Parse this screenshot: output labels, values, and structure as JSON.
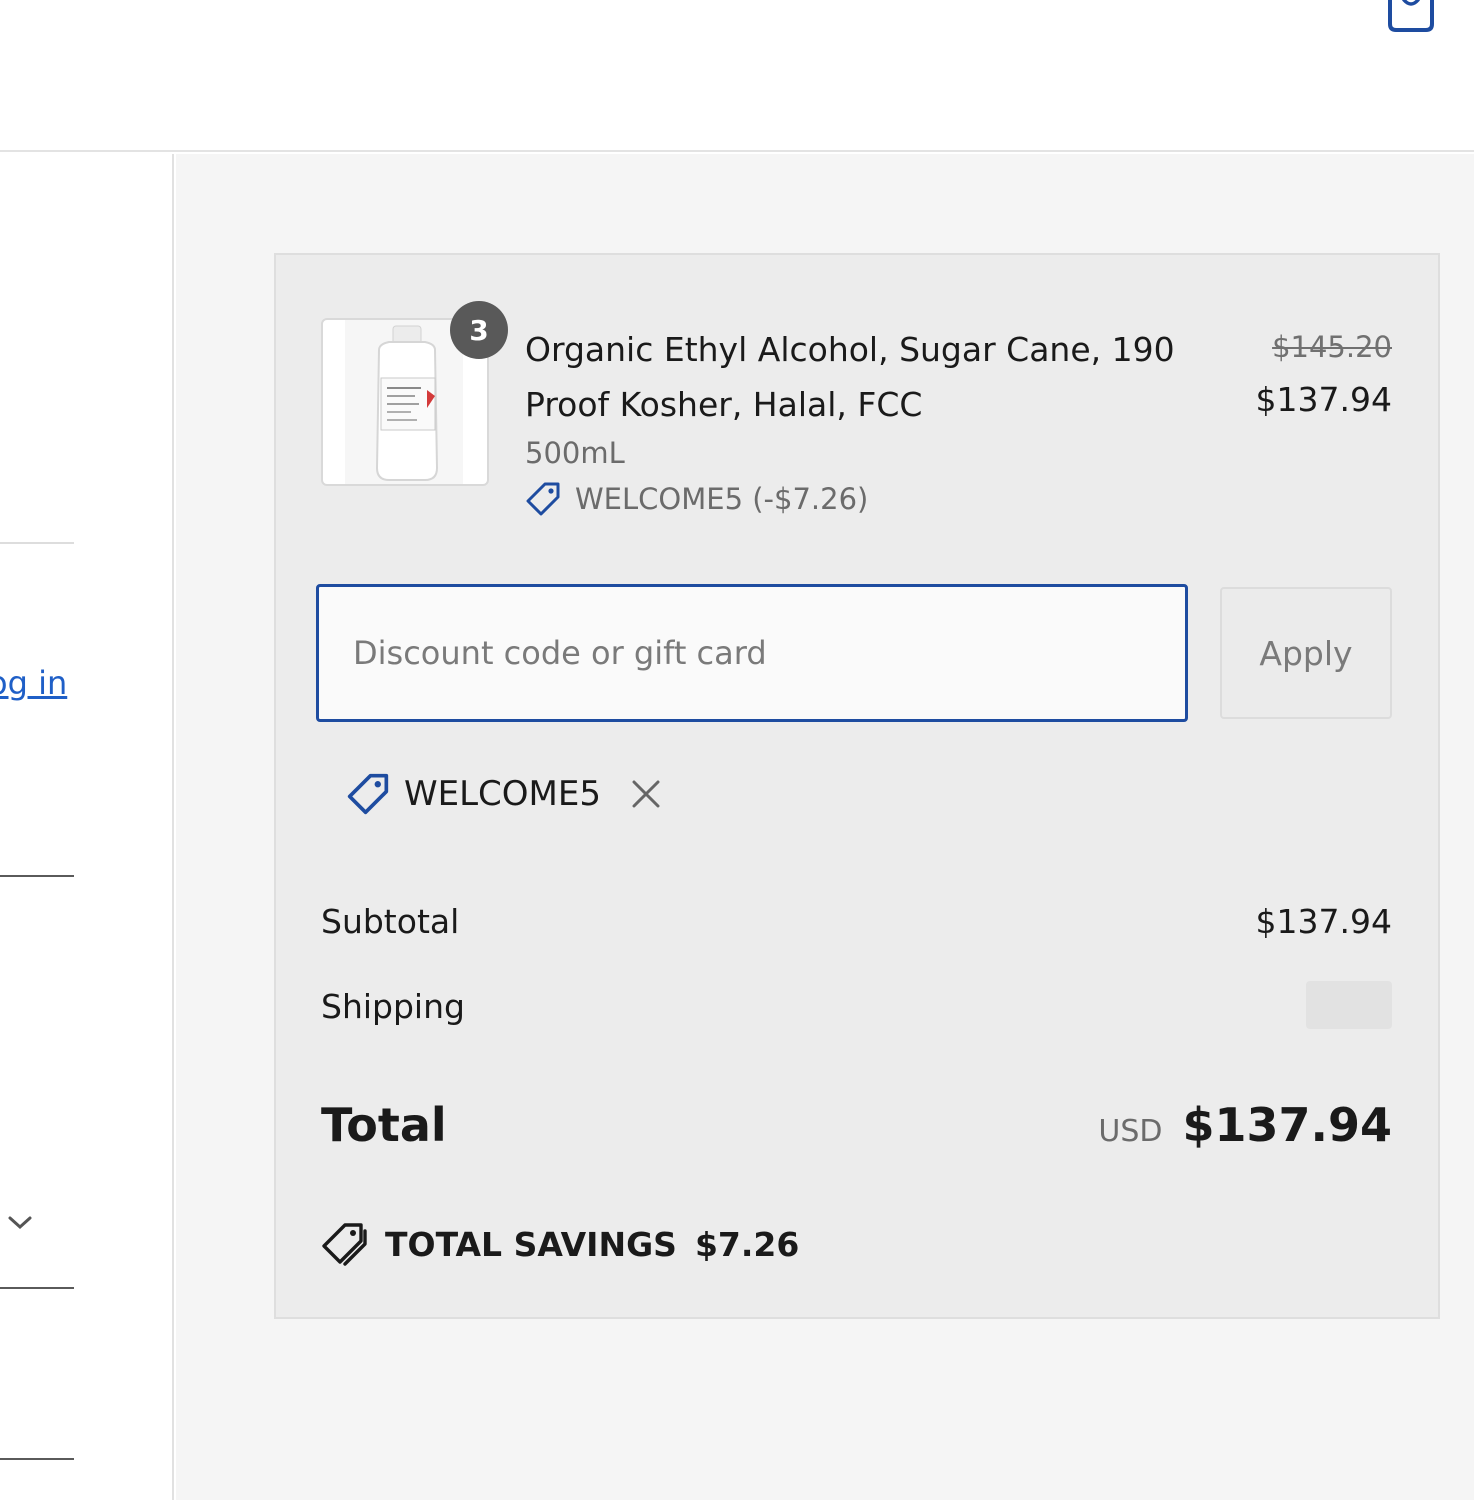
{
  "header": {
    "cart_icon": "shopping-bag-icon"
  },
  "left": {
    "login_link": "og in",
    "chevron_icon": "chevron-down-icon"
  },
  "order_summary": {
    "item": {
      "quantity": "3",
      "title": "Organic Ethyl Alcohol, Sugar Cane, 190 Proof Kosher, Halal, FCC",
      "variant": "500mL",
      "discount": "WELCOME5 (-$7.26)",
      "original_price": "$145.20",
      "price": "$137.94",
      "thumbnail": "product-bottle-image"
    },
    "discount_field": {
      "placeholder": "Discount code or gift card",
      "value": ""
    },
    "apply_label": "Apply",
    "applied_code": "WELCOME5",
    "subtotal_label": "Subtotal",
    "subtotal_value": "$137.94",
    "shipping_label": "Shipping",
    "total_label": "Total",
    "currency": "USD",
    "total_value": "$137.94",
    "savings_label": "TOTAL SAVINGS",
    "savings_value": "$7.26"
  },
  "colors": {
    "accent": "#1e4ca0",
    "link": "#1f5fc7",
    "card_bg": "#ececec",
    "pane_bg": "#f5f5f5",
    "badge_bg": "#595959"
  }
}
